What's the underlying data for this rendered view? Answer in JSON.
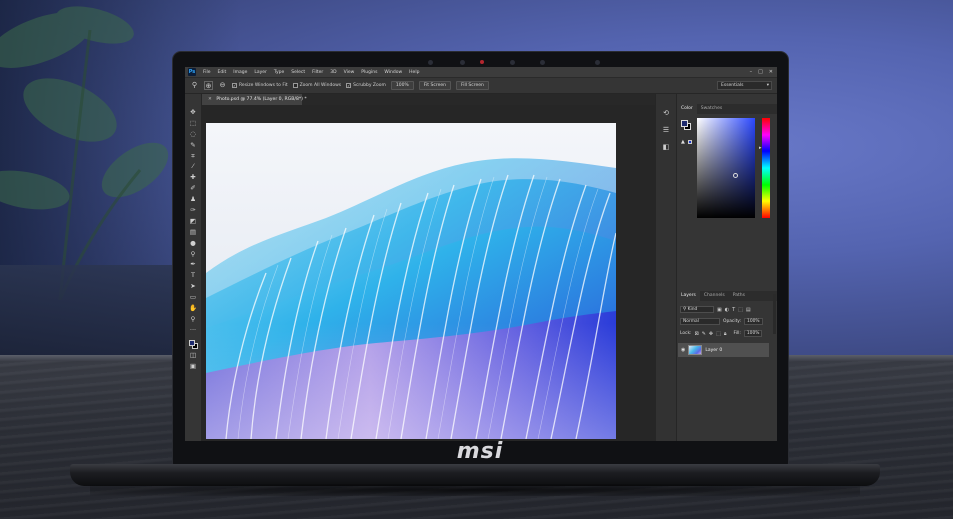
{
  "brand": "msi",
  "photoshop": {
    "app_icon": "Ps",
    "menu": [
      "File",
      "Edit",
      "Image",
      "Layer",
      "Type",
      "Select",
      "Filter",
      "3D",
      "View",
      "Plugins",
      "Window",
      "Help"
    ],
    "window_controls": [
      "minimize-icon",
      "maximize-icon",
      "close-icon"
    ],
    "options_bar": {
      "zoom_tool_icon": "magnifier-icon",
      "zoom_in_icon": "zoom-in-icon",
      "zoom_out_icon": "zoom-out-icon",
      "resize_windows_label": "Resize Windows to Fit",
      "zoom_all_label": "Zoom All Windows",
      "scrubby_label": "Scrubby Zoom",
      "zoom_percent_btn": "100%",
      "fit_screen_btn": "Fit Screen",
      "fill_screen_btn": "Fill Screen",
      "resize_checked": true,
      "zoom_all_checked": false,
      "scrubby_checked": true
    },
    "workspace": "Essentials",
    "document_tab": "Photo.psd @ 77.4% (Layer 0, RGB/8*) *",
    "color_panel": {
      "tabs": [
        "Color",
        "Swatches"
      ],
      "foreground": "#1d2a6e",
      "background": "#000000",
      "hue": "#2b48ff"
    },
    "layers_panel": {
      "tabs": [
        "Layers",
        "Channels",
        "Paths"
      ],
      "filter_kind": "Kind",
      "blend_mode": "Normal",
      "opacity_label": "Opacity:",
      "opacity_value": "100%",
      "lock_label": "Lock:",
      "fill_label": "Fill:",
      "fill_value": "100%",
      "layer_name": "Layer 0"
    }
  }
}
